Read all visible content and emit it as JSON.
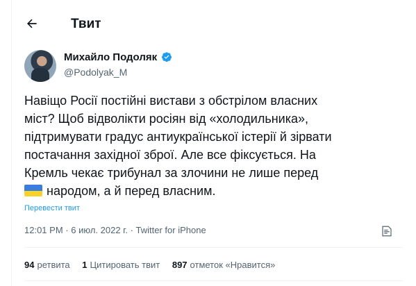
{
  "header": {
    "title": "Твит"
  },
  "author": {
    "name": "Михайло Подоляк",
    "handle": "@Podolyak_M"
  },
  "tweet": {
    "lines": [
      "Навіщо Росії постійні вистави з обстрілом власних",
      "міст? Щоб відволікти росіян від «холодильника»,",
      "підтримувати градус антиукраїнської істерії й зірвати",
      "постачання західної зброї. Але все фіксується. На",
      "Кремль чекає трибунал за злочини не лише перед",
      "народом, а й перед власним."
    ],
    "translate_label": "Перевести твит"
  },
  "meta": {
    "time": "12:01 PM",
    "date": "6 июл. 2022 г.",
    "source": "Twitter for iPhone",
    "separator": "·"
  },
  "stats": {
    "retweets_count": "94",
    "retweets_label": "ретвита",
    "quotes_count": "1",
    "quotes_label": "Цитировать твит",
    "likes_count": "897",
    "likes_label": "отметок «Нравится»"
  },
  "colors": {
    "accent": "#1d9bf0",
    "flag_blue": "#3b7ddd",
    "flag_yellow": "#f7d229"
  },
  "icons": {
    "back": "arrow-left-icon",
    "verified": "verified-badge-icon",
    "analytics": "analytics-icon"
  }
}
